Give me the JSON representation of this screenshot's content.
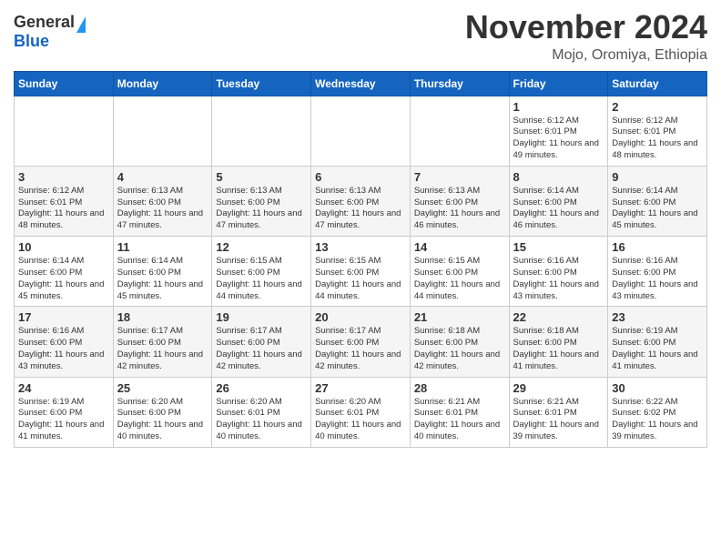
{
  "header": {
    "logo": {
      "general": "General",
      "blue": "Blue"
    },
    "title": "November 2024",
    "location": "Mojo, Oromiya, Ethiopia"
  },
  "weekdays": [
    "Sunday",
    "Monday",
    "Tuesday",
    "Wednesday",
    "Thursday",
    "Friday",
    "Saturday"
  ],
  "weeks": [
    [
      {
        "day": "",
        "info": ""
      },
      {
        "day": "",
        "info": ""
      },
      {
        "day": "",
        "info": ""
      },
      {
        "day": "",
        "info": ""
      },
      {
        "day": "",
        "info": ""
      },
      {
        "day": "1",
        "info": "Sunrise: 6:12 AM\nSunset: 6:01 PM\nDaylight: 11 hours and 49 minutes."
      },
      {
        "day": "2",
        "info": "Sunrise: 6:12 AM\nSunset: 6:01 PM\nDaylight: 11 hours and 48 minutes."
      }
    ],
    [
      {
        "day": "3",
        "info": "Sunrise: 6:12 AM\nSunset: 6:01 PM\nDaylight: 11 hours and 48 minutes."
      },
      {
        "day": "4",
        "info": "Sunrise: 6:13 AM\nSunset: 6:00 PM\nDaylight: 11 hours and 47 minutes."
      },
      {
        "day": "5",
        "info": "Sunrise: 6:13 AM\nSunset: 6:00 PM\nDaylight: 11 hours and 47 minutes."
      },
      {
        "day": "6",
        "info": "Sunrise: 6:13 AM\nSunset: 6:00 PM\nDaylight: 11 hours and 47 minutes."
      },
      {
        "day": "7",
        "info": "Sunrise: 6:13 AM\nSunset: 6:00 PM\nDaylight: 11 hours and 46 minutes."
      },
      {
        "day": "8",
        "info": "Sunrise: 6:14 AM\nSunset: 6:00 PM\nDaylight: 11 hours and 46 minutes."
      },
      {
        "day": "9",
        "info": "Sunrise: 6:14 AM\nSunset: 6:00 PM\nDaylight: 11 hours and 45 minutes."
      }
    ],
    [
      {
        "day": "10",
        "info": "Sunrise: 6:14 AM\nSunset: 6:00 PM\nDaylight: 11 hours and 45 minutes."
      },
      {
        "day": "11",
        "info": "Sunrise: 6:14 AM\nSunset: 6:00 PM\nDaylight: 11 hours and 45 minutes."
      },
      {
        "day": "12",
        "info": "Sunrise: 6:15 AM\nSunset: 6:00 PM\nDaylight: 11 hours and 44 minutes."
      },
      {
        "day": "13",
        "info": "Sunrise: 6:15 AM\nSunset: 6:00 PM\nDaylight: 11 hours and 44 minutes."
      },
      {
        "day": "14",
        "info": "Sunrise: 6:15 AM\nSunset: 6:00 PM\nDaylight: 11 hours and 44 minutes."
      },
      {
        "day": "15",
        "info": "Sunrise: 6:16 AM\nSunset: 6:00 PM\nDaylight: 11 hours and 43 minutes."
      },
      {
        "day": "16",
        "info": "Sunrise: 6:16 AM\nSunset: 6:00 PM\nDaylight: 11 hours and 43 minutes."
      }
    ],
    [
      {
        "day": "17",
        "info": "Sunrise: 6:16 AM\nSunset: 6:00 PM\nDaylight: 11 hours and 43 minutes."
      },
      {
        "day": "18",
        "info": "Sunrise: 6:17 AM\nSunset: 6:00 PM\nDaylight: 11 hours and 42 minutes."
      },
      {
        "day": "19",
        "info": "Sunrise: 6:17 AM\nSunset: 6:00 PM\nDaylight: 11 hours and 42 minutes."
      },
      {
        "day": "20",
        "info": "Sunrise: 6:17 AM\nSunset: 6:00 PM\nDaylight: 11 hours and 42 minutes."
      },
      {
        "day": "21",
        "info": "Sunrise: 6:18 AM\nSunset: 6:00 PM\nDaylight: 11 hours and 42 minutes."
      },
      {
        "day": "22",
        "info": "Sunrise: 6:18 AM\nSunset: 6:00 PM\nDaylight: 11 hours and 41 minutes."
      },
      {
        "day": "23",
        "info": "Sunrise: 6:19 AM\nSunset: 6:00 PM\nDaylight: 11 hours and 41 minutes."
      }
    ],
    [
      {
        "day": "24",
        "info": "Sunrise: 6:19 AM\nSunset: 6:00 PM\nDaylight: 11 hours and 41 minutes."
      },
      {
        "day": "25",
        "info": "Sunrise: 6:20 AM\nSunset: 6:00 PM\nDaylight: 11 hours and 40 minutes."
      },
      {
        "day": "26",
        "info": "Sunrise: 6:20 AM\nSunset: 6:01 PM\nDaylight: 11 hours and 40 minutes."
      },
      {
        "day": "27",
        "info": "Sunrise: 6:20 AM\nSunset: 6:01 PM\nDaylight: 11 hours and 40 minutes."
      },
      {
        "day": "28",
        "info": "Sunrise: 6:21 AM\nSunset: 6:01 PM\nDaylight: 11 hours and 40 minutes."
      },
      {
        "day": "29",
        "info": "Sunrise: 6:21 AM\nSunset: 6:01 PM\nDaylight: 11 hours and 39 minutes."
      },
      {
        "day": "30",
        "info": "Sunrise: 6:22 AM\nSunset: 6:02 PM\nDaylight: 11 hours and 39 minutes."
      }
    ]
  ]
}
